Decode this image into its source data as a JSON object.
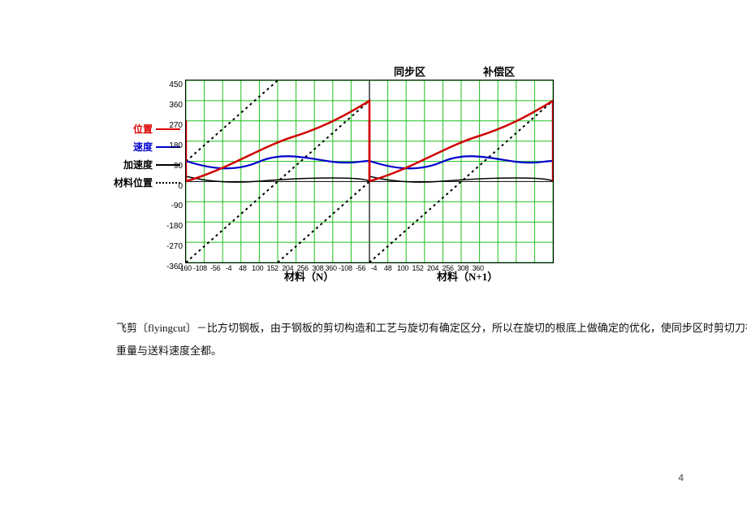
{
  "doc": {
    "page_number": "4",
    "paragraph_line1": "    飞剪〔flyingcut〕－比方切钢板，由于钢板的剪切构造和工艺与旋切有确定区分，所以在旋切的根底上做确定的优化，使同步区时剪切刀在送料方向上      的",
    "paragraph_line2": "    重量与送料速度全都。"
  },
  "zones": {
    "sync_label": "同步区",
    "comp_label": "补偿区"
  },
  "legend": {
    "position": "位置",
    "speed": "速度",
    "accel": "加速度",
    "material_pos": "材料位置"
  },
  "xaxis": {
    "label_n": "材料（N）",
    "label_n1": "材料（N+1）"
  },
  "chart_data": {
    "type": "line",
    "title": "",
    "xlabel_left": "材料（N）",
    "xlabel_right": "材料（N+1）",
    "ylabel": "",
    "ylim": [
      -360,
      450
    ],
    "x_ticks": [
      -160,
      -108,
      -56,
      -4,
      48,
      100,
      152,
      204,
      256,
      308,
      360,
      -108,
      -56,
      -4,
      48,
      100,
      152,
      204,
      256,
      308,
      360
    ],
    "y_ticks": [
      -360,
      -270,
      -180,
      -90,
      0,
      90,
      180,
      270,
      360,
      450
    ],
    "zones": [
      {
        "name": "同步区",
        "x_range": [
          256,
          360
        ],
        "panel": "left"
      },
      {
        "name": "补偿区",
        "x_range": [
          -160,
          0
        ],
        "panel": "right_overlap"
      }
    ],
    "series": [
      {
        "name": "位置",
        "color": "#d00000",
        "style": "solid",
        "x": [
          -160,
          48,
          256,
          360
        ],
        "y": [
          0,
          150,
          270,
          360
        ],
        "periodic": true
      },
      {
        "name": "速度",
        "color": "#0000cc",
        "style": "solid",
        "x": [
          -160,
          -56,
          48,
          152,
          256,
          360
        ],
        "y": [
          90,
          60,
          100,
          60,
          100,
          90
        ],
        "periodic": true
      },
      {
        "name": "加速度",
        "color": "#000",
        "style": "solid",
        "x": [
          -160,
          48,
          256,
          360
        ],
        "y": [
          30,
          -15,
          15,
          0
        ],
        "periodic": true
      },
      {
        "name": "材料位置",
        "color": "#000",
        "style": "dotted",
        "x": [
          -160,
          360
        ],
        "y": [
          -360,
          360
        ],
        "periodic": true
      }
    ]
  }
}
